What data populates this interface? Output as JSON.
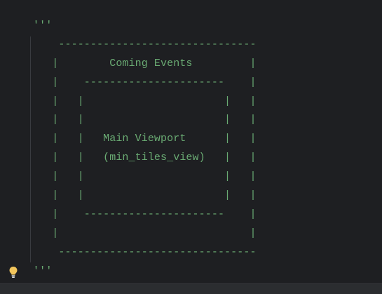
{
  "editor": {
    "lines": [
      "'''",
      "    -------------------------------",
      "   |        Coming Events         |",
      "   |    ----------------------    |",
      "   |   |                      |   |",
      "   |   |                      |   |",
      "   |   |   Main Viewport      |   |",
      "   |   |   (min_tiles_view)   |   |",
      "   |   |                      |   |",
      "   |   |                      |   |",
      "   |    ----------------------    |",
      "   |                              |",
      "    -------------------------------",
      "'''"
    ]
  },
  "gutter": {
    "intention_icon": "lightbulb-icon"
  },
  "colors": {
    "background": "#1e1f22",
    "string_text": "#6aab73",
    "bulb": "#f2c55c"
  }
}
